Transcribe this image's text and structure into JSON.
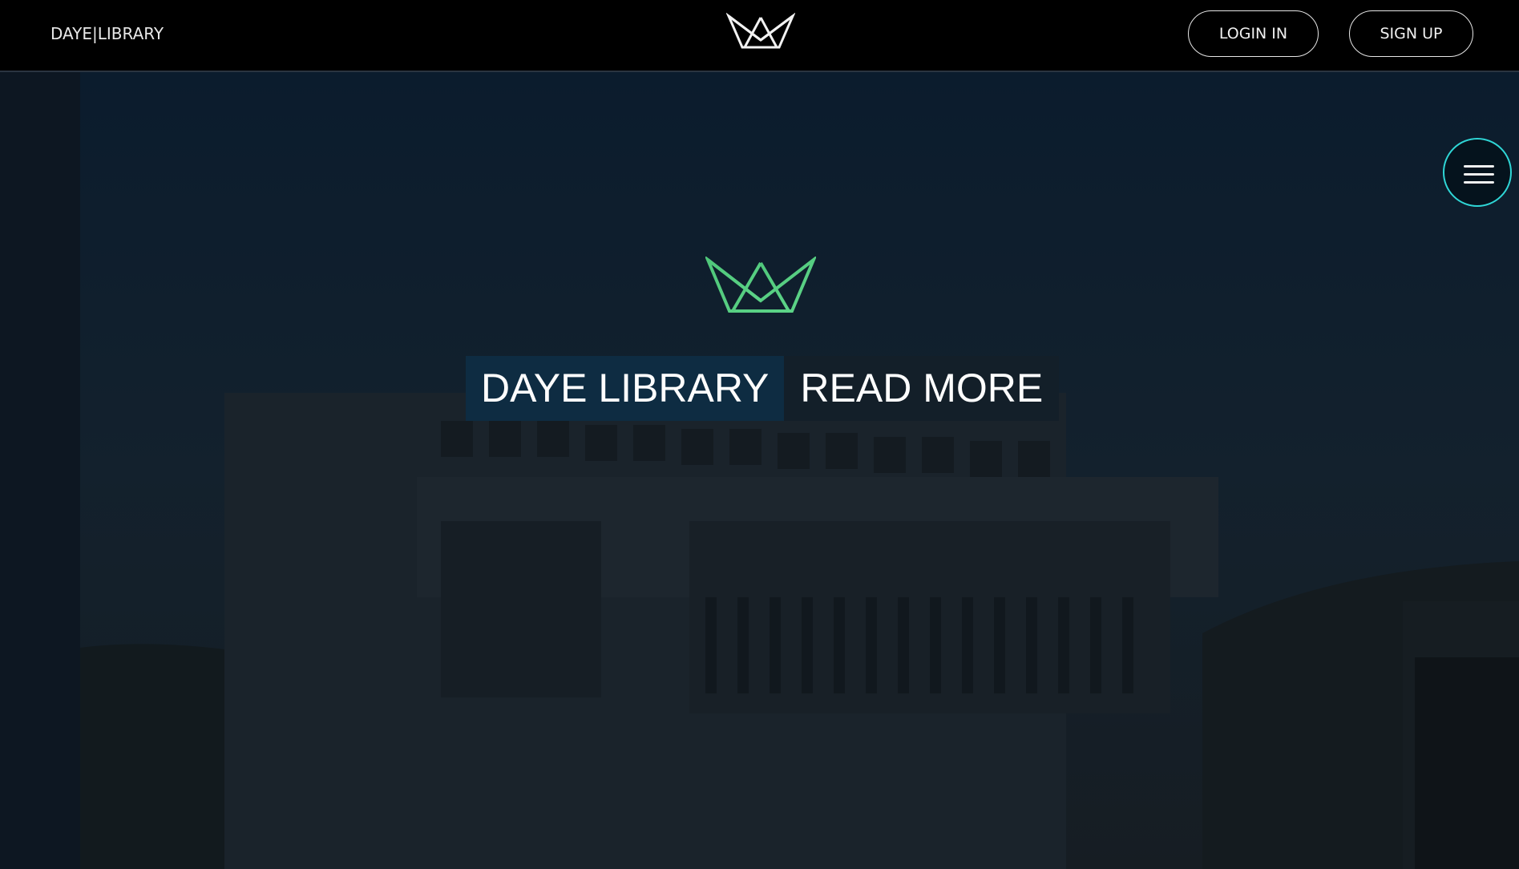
{
  "header": {
    "brand": "DAYE|LIBRARY",
    "logo_icon": "crown-logo-icon",
    "login_label": "LOGIN IN",
    "signup_label": "SIGN UP"
  },
  "hero": {
    "logo_icon": "crown-logo-icon",
    "logo_color": "#4fc77a",
    "title": "DAYE LIBRARY",
    "read_more_label": "READ MORE",
    "menu_icon": "hamburger-menu-icon",
    "menu_ring_color": "#2fd6d6"
  }
}
